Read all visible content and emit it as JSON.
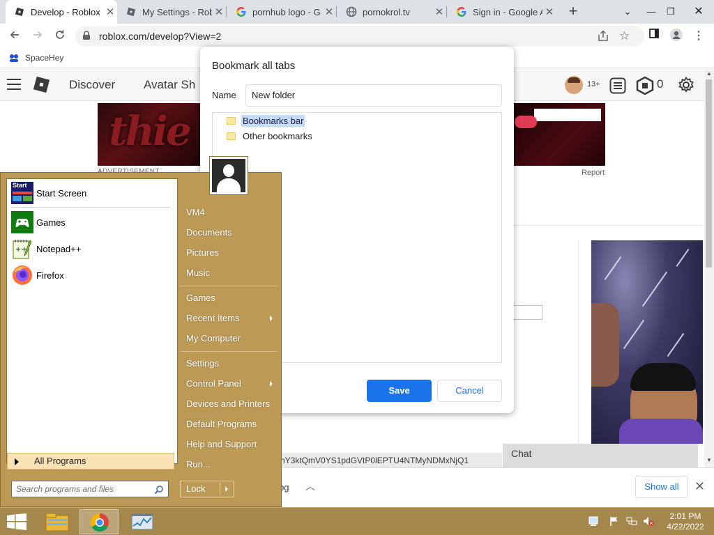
{
  "browser": {
    "tabs": [
      {
        "title": "Develop - Roblox",
        "active": true,
        "icon": "roblox-icon"
      },
      {
        "title": "My Settings - Rob",
        "active": false,
        "icon": "roblox-icon"
      },
      {
        "title": "pornhub logo - G",
        "active": false,
        "icon": "google-icon"
      },
      {
        "title": "pornokrol.tv",
        "active": false,
        "icon": "globe-icon"
      },
      {
        "title": "Sign in - Google A",
        "active": false,
        "icon": "google-icon"
      }
    ],
    "url": "roblox.com/develop?View=2",
    "bookmarks": [
      {
        "label": "SpaceHey",
        "icon": "spacehey-icon"
      }
    ]
  },
  "roblox": {
    "nav": [
      "Discover",
      "Avatar Sh"
    ],
    "age_badge": "13+",
    "robux": "0",
    "ad_label": "ADVERTISEMENT",
    "report_label": "Report",
    "ad_text": "thie",
    "token_text": "ry1MZWdhY3ktQmV0YS1pdGVtP0lEPTU4NTMyNDMxNjQ1",
    "chat_label": "Chat"
  },
  "dialog": {
    "title": "Bookmark all tabs",
    "name_label": "Name",
    "name_value": "New folder",
    "folders": [
      {
        "label": "Bookmarks bar",
        "selected": true
      },
      {
        "label": "Other bookmarks",
        "selected": false
      }
    ],
    "save_label": "Save",
    "cancel_label": "Cancel"
  },
  "downloads": {
    "file_name": "pg",
    "show_all_label": "Show all"
  },
  "start_menu": {
    "pinned": [
      {
        "label": "Start Screen",
        "icon": "start-screen-icon",
        "badge": "Start"
      },
      {
        "label": "Games",
        "icon": "xbox-games-icon"
      },
      {
        "label": "Notepad++",
        "icon": "notepadpp-icon"
      },
      {
        "label": "Firefox",
        "icon": "firefox-icon"
      }
    ],
    "all_programs_label": "All Programs",
    "search_placeholder": "Search programs and files",
    "right_items": [
      {
        "label": "VM4",
        "submenu": false
      },
      {
        "label": "Documents",
        "submenu": false
      },
      {
        "label": "Pictures",
        "submenu": false
      },
      {
        "label": "Music",
        "submenu": false
      },
      {
        "label": "Games",
        "submenu": false
      },
      {
        "label": "Recent Items",
        "submenu": true
      },
      {
        "label": "My Computer",
        "submenu": false
      },
      {
        "label": "Settings",
        "submenu": false
      },
      {
        "label": "Control Panel",
        "submenu": true
      },
      {
        "label": "Devices and Printers",
        "submenu": false
      },
      {
        "label": "Default Programs",
        "submenu": false
      },
      {
        "label": "Help and Support",
        "submenu": false
      },
      {
        "label": "Run...",
        "submenu": false
      }
    ],
    "lock_label": "Lock"
  },
  "taskbar": {
    "time": "2:01 PM",
    "date": "4/22/2022",
    "apps": [
      "file-explorer-icon",
      "chrome-icon",
      "task-manager-icon"
    ]
  },
  "colors": {
    "start_menu_bg": "#bc9a56",
    "taskbar_bg": "#a4874c",
    "accent_blue": "#1a73e8",
    "selection": "#c2dbff"
  }
}
